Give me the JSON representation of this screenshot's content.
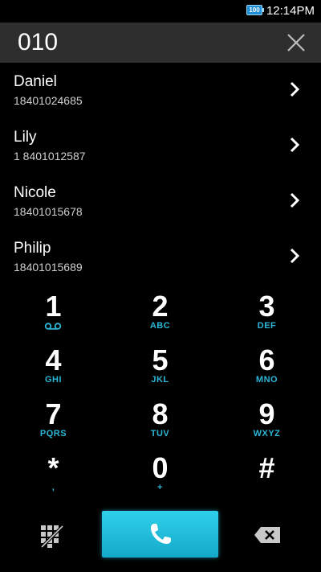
{
  "status_bar": {
    "battery_level": "100",
    "time": "12:14PM"
  },
  "dialer": {
    "input_value": "010"
  },
  "contacts": [
    {
      "name": "Daniel",
      "number": "18401024685"
    },
    {
      "name": "Lily",
      "number": "1 8401012587"
    },
    {
      "name": "Nicole",
      "number": "18401015678"
    },
    {
      "name": "Philip",
      "number": "18401015689"
    }
  ],
  "keypad": {
    "keys": [
      {
        "digit": "1",
        "letters": ""
      },
      {
        "digit": "2",
        "letters": "ABC"
      },
      {
        "digit": "3",
        "letters": "DEF"
      },
      {
        "digit": "4",
        "letters": "GHI"
      },
      {
        "digit": "5",
        "letters": "JKL"
      },
      {
        "digit": "6",
        "letters": "MNO"
      },
      {
        "digit": "7",
        "letters": "PQRS"
      },
      {
        "digit": "8",
        "letters": "TUV"
      },
      {
        "digit": "9",
        "letters": "WXYZ"
      },
      {
        "digit": "*",
        "letters": ","
      },
      {
        "digit": "0",
        "letters": "+"
      },
      {
        "digit": "#",
        "letters": ""
      }
    ]
  },
  "icons": {
    "clear": "close-icon",
    "chevron": "chevron-right-icon",
    "voicemail": "voicemail-icon",
    "dialpad": "dialpad-icon",
    "call": "phone-icon",
    "backspace": "backspace-icon"
  },
  "colors": {
    "accent": "#2bb6d6",
    "call_button": "#1fbfdc",
    "input_bar": "#2e2e2e",
    "background": "#000000"
  }
}
